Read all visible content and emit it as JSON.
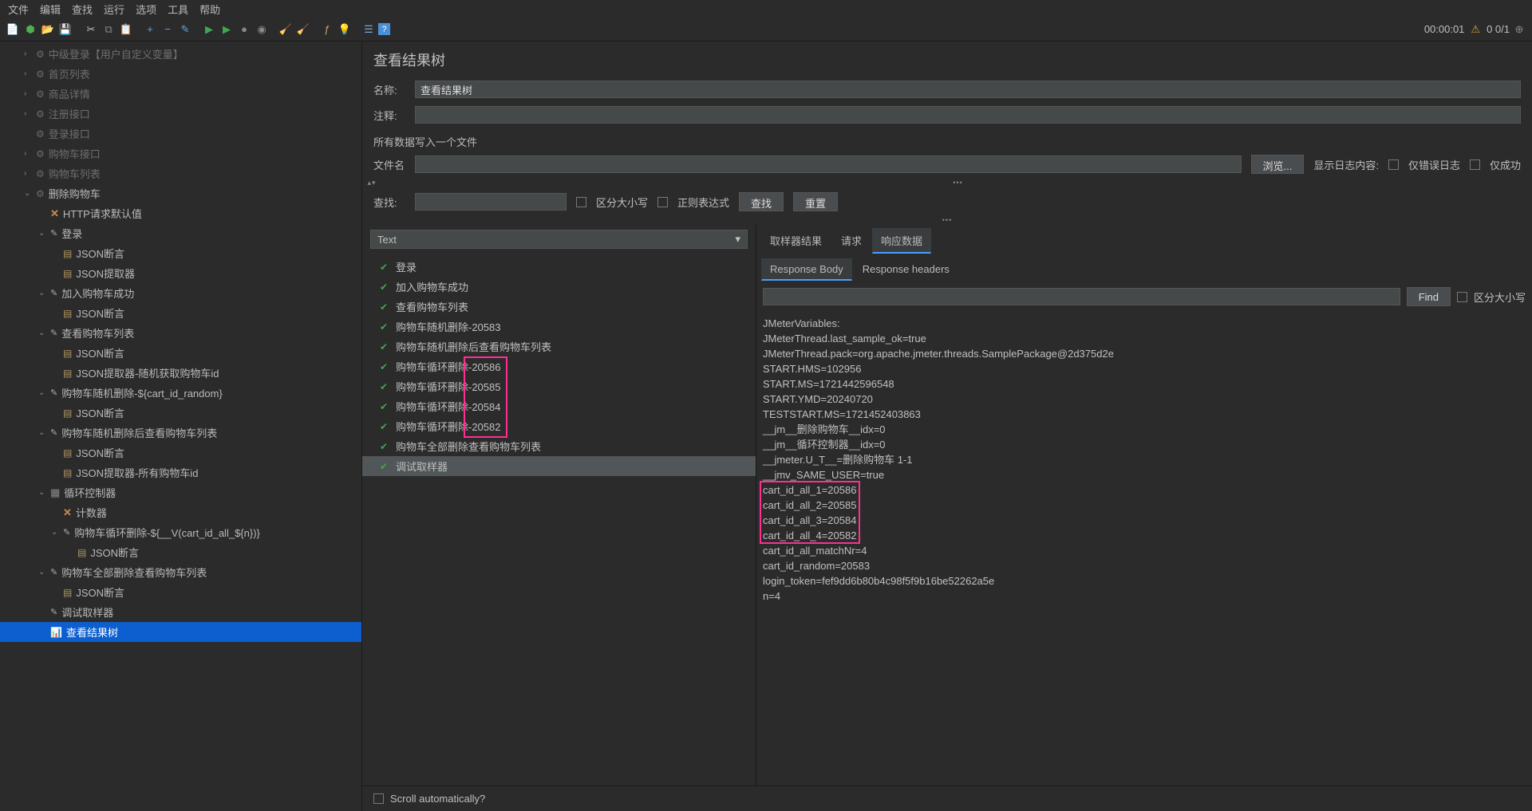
{
  "menu": {
    "file": "文件",
    "edit": "编辑",
    "search": "查找",
    "run": "运行",
    "options": "选项",
    "tools": "工具",
    "help": "帮助"
  },
  "status": {
    "time": "00:00:01",
    "count": "0 0/1"
  },
  "tree": {
    "items": [
      {
        "label": "中级登录【用户自定义变量】",
        "lvl": "indent1",
        "icon": "gear",
        "caret": "right",
        "dim": true
      },
      {
        "label": "首页列表",
        "lvl": "indent1",
        "icon": "gear",
        "caret": "right",
        "dim": true
      },
      {
        "label": "商品详情",
        "lvl": "indent1",
        "icon": "gear",
        "caret": "right",
        "dim": true
      },
      {
        "label": "注册接口",
        "lvl": "indent1",
        "icon": "gear",
        "caret": "right",
        "dim": true
      },
      {
        "label": "登录接口",
        "lvl": "indent1",
        "icon": "gear",
        "dim": true
      },
      {
        "label": "购物车接口",
        "lvl": "indent1",
        "icon": "gear",
        "caret": "right",
        "dim": true
      },
      {
        "label": "购物车列表",
        "lvl": "indent1",
        "icon": "gear",
        "caret": "right",
        "dim": true
      },
      {
        "label": "删除购物车",
        "lvl": "indent1",
        "icon": "gear",
        "caret": "down"
      },
      {
        "label": "HTTP请求默认值",
        "lvl": "indent2",
        "icon": "x"
      },
      {
        "label": "登录",
        "lvl": "indent2",
        "icon": "pencil",
        "caret": "down"
      },
      {
        "label": "JSON断言",
        "lvl": "indent3",
        "icon": "doc"
      },
      {
        "label": "JSON提取器",
        "lvl": "indent3",
        "icon": "doc"
      },
      {
        "label": "加入购物车成功",
        "lvl": "indent2",
        "icon": "pencil",
        "caret": "down"
      },
      {
        "label": "JSON断言",
        "lvl": "indent3",
        "icon": "doc"
      },
      {
        "label": "查看购物车列表",
        "lvl": "indent2",
        "icon": "pencil",
        "caret": "down"
      },
      {
        "label": "JSON断言",
        "lvl": "indent3",
        "icon": "doc"
      },
      {
        "label": "JSON提取器-随机获取购物车id",
        "lvl": "indent3",
        "icon": "doc"
      },
      {
        "label": "购物车随机删除-${cart_id_random}",
        "lvl": "indent2",
        "icon": "pencil",
        "caret": "down"
      },
      {
        "label": "JSON断言",
        "lvl": "indent3",
        "icon": "doc"
      },
      {
        "label": "购物车随机删除后查看购物车列表",
        "lvl": "indent2",
        "icon": "pencil",
        "caret": "down"
      },
      {
        "label": "JSON断言",
        "lvl": "indent3",
        "icon": "doc"
      },
      {
        "label": "JSON提取器-所有购物车id",
        "lvl": "indent3",
        "icon": "doc"
      },
      {
        "label": "循环控制器",
        "lvl": "indent2",
        "icon": "loop",
        "caret": "down"
      },
      {
        "label": "计数器",
        "lvl": "indent3",
        "icon": "x"
      },
      {
        "label": "购物车循环删除-${__V(cart_id_all_${n})}",
        "lvl": "indent3",
        "icon": "pencil",
        "caret": "down"
      },
      {
        "label": "JSON断言",
        "lvl": "indent4",
        "icon": "doc"
      },
      {
        "label": "购物车全部删除查看购物车列表",
        "lvl": "indent2",
        "icon": "pencil",
        "caret": "down"
      },
      {
        "label": "JSON断言",
        "lvl": "indent3",
        "icon": "doc"
      },
      {
        "label": "调试取样器",
        "lvl": "indent2",
        "icon": "pencil"
      },
      {
        "label": "查看结果树",
        "lvl": "indent2",
        "icon": "graph",
        "selected": true
      }
    ]
  },
  "panel": {
    "title": "查看结果树",
    "name_label": "名称:",
    "name_value": "查看结果树",
    "comment_label": "注释:",
    "section": "所有数据写入一个文件",
    "file_label": "文件名",
    "browse": "浏览...",
    "showlog": "显示日志内容:",
    "only_err": "仅错误日志",
    "only_ok": "仅成功",
    "search_label": "查找:",
    "case": "区分大小写",
    "regex": "正则表达式",
    "search_btn": "查找",
    "reset_btn": "重置",
    "renderer": "Text"
  },
  "results": [
    {
      "label": "登录"
    },
    {
      "label": "加入购物车成功"
    },
    {
      "label": "查看购物车列表"
    },
    {
      "label": "购物车随机删除-20583"
    },
    {
      "label": "购物车随机删除后查看购物车列表"
    },
    {
      "label": "购物车循环删除-20586"
    },
    {
      "label": "购物车循环删除-20585"
    },
    {
      "label": "购物车循环删除-20584"
    },
    {
      "label": "购物车循环删除-20582"
    },
    {
      "label": "购物车全部删除查看购物车列表"
    },
    {
      "label": "调试取样器",
      "sel": true
    }
  ],
  "tabs": {
    "sampler": "取样器结果",
    "request": "请求",
    "response": "响应数据"
  },
  "subtabs": {
    "body": "Response Body",
    "headers": "Response headers"
  },
  "find_btn": "Find",
  "find_case": "区分大小写",
  "response": [
    "JMeterVariables:",
    "JMeterThread.last_sample_ok=true",
    "JMeterThread.pack=org.apache.jmeter.threads.SamplePackage@2d375d2e",
    "START.HMS=102956",
    "START.MS=1721442596548",
    "START.YMD=20240720",
    "TESTSTART.MS=1721452403863",
    "__jm__删除购物车__idx=0",
    "__jm__循环控制器__idx=0",
    "__jmeter.U_T__=删除购物车 1-1",
    "__jmv_SAME_USER=true",
    "cart_id_all_1=20586",
    "cart_id_all_2=20585",
    "cart_id_all_3=20584",
    "cart_id_all_4=20582",
    "cart_id_all_matchNr=4",
    "cart_id_random=20583",
    "login_token=fef9dd6b80b4c98f5f9b16be52262a5e",
    "n=4"
  ],
  "scroll_label": "Scroll automatically?"
}
